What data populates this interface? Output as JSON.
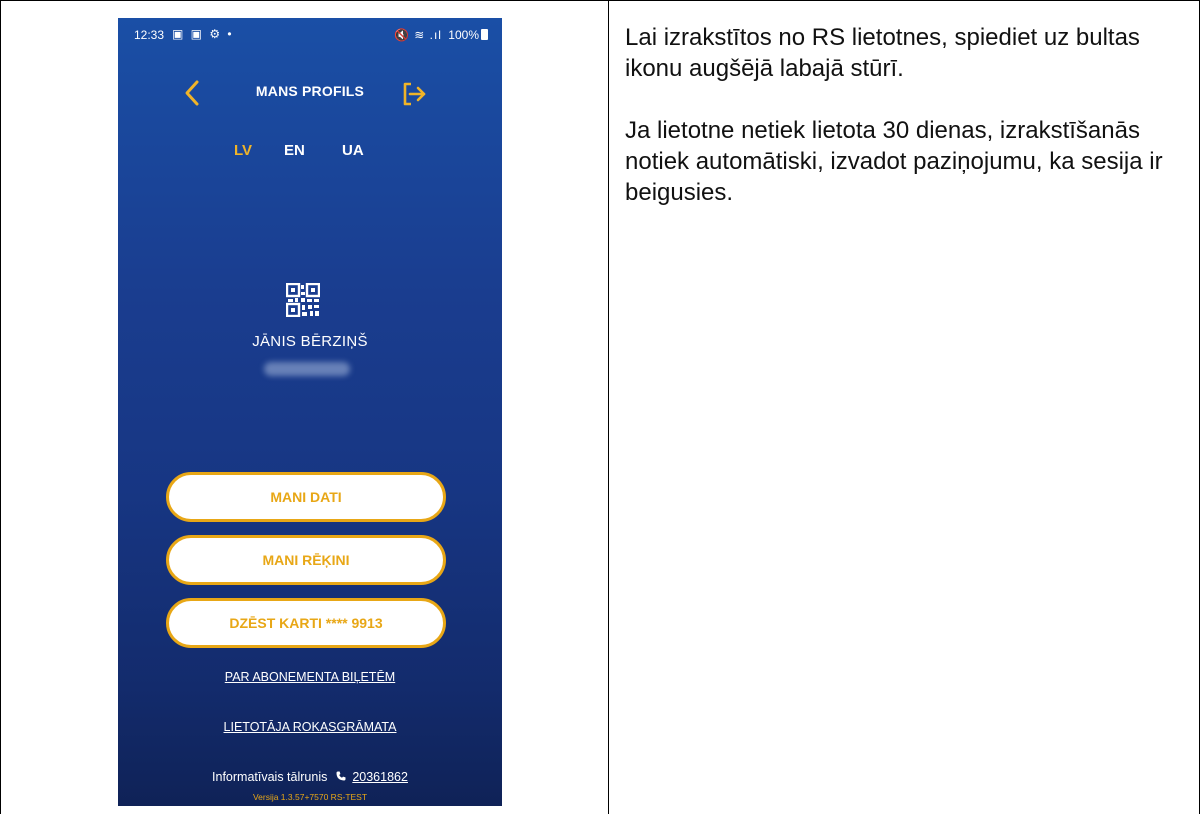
{
  "status_bar": {
    "time": "12:33",
    "left_icons": "▣ ▣ ⚙ •",
    "signal": "🔇 ≋ .ıl",
    "battery": "100%"
  },
  "header": {
    "title": "MANS PROFILS",
    "back_icon": "chevron-left-icon",
    "logout_icon": "logout-arrow-icon"
  },
  "languages": [
    {
      "code": "LV",
      "active": true
    },
    {
      "code": "EN",
      "active": false
    },
    {
      "code": "UA",
      "active": false
    }
  ],
  "profile": {
    "qr_icon": "qr-code-icon",
    "name": "JĀNIS BĒRZIŅŠ"
  },
  "buttons": {
    "my_data": "MANI DATI",
    "my_invoices": "MANI RĒĶINI",
    "delete_card": "DZĒST KARTI **** 9913"
  },
  "links": {
    "subscription_tickets": "PAR ABONEMENTA BIĻETĒM",
    "user_manual": "LIETOTĀJA ROKASGRĀMATA"
  },
  "info": {
    "label": "Informatīvais tālrunis",
    "phone_icon": "phone-icon",
    "phone": "20361862",
    "version": "Versija 1.3.57+7570 RS-TEST"
  },
  "instructions": [
    "Lai izrakstītos no RS lietotnes, spiediet uz bultas ikonu augšējā labajā stūrī.",
    "Ja lietotne netiek lietota 30 dienas, izrakstīšanās notiek automātiski, izvadot paziņojumu, ka sesija ir beigusies."
  ],
  "colors": {
    "accent": "#e8a716",
    "background_top": "#1a4fa6",
    "background_bottom": "#0f2257"
  }
}
